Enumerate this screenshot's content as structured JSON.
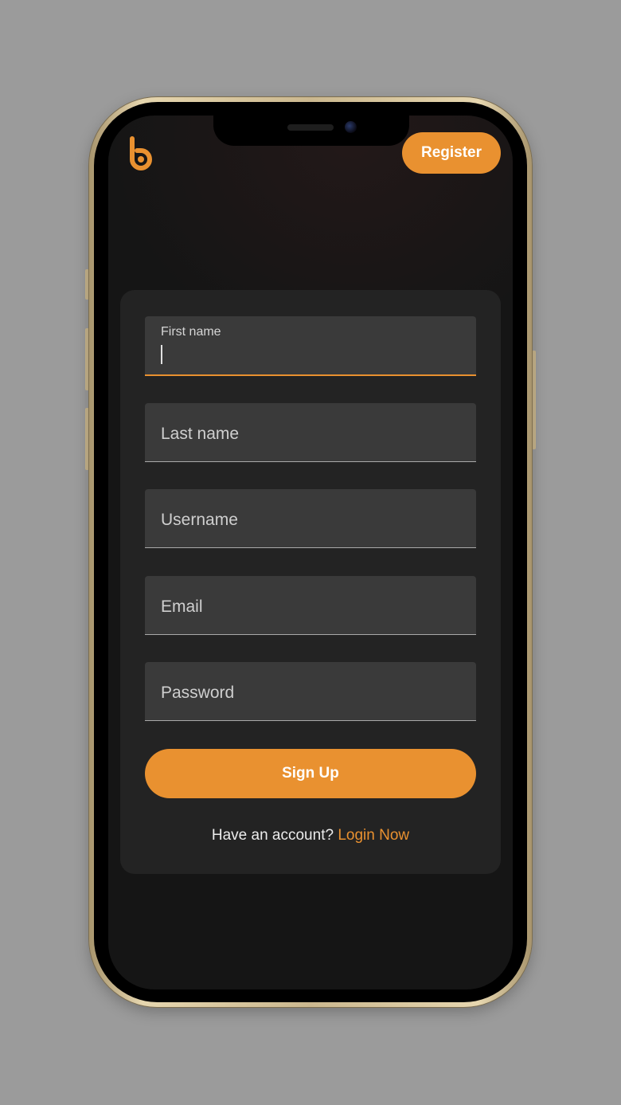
{
  "header": {
    "logo_icon": "brand-b-logo-icon",
    "register_label": "Register"
  },
  "form": {
    "fields": [
      {
        "label": "First name",
        "value": "",
        "focused": true
      },
      {
        "label": "Last name",
        "value": "",
        "focused": false
      },
      {
        "label": "Username",
        "value": "",
        "focused": false
      },
      {
        "label": "Email",
        "value": "",
        "focused": false
      },
      {
        "label": "Password",
        "value": "",
        "focused": false
      }
    ],
    "submit_label": "Sign Up",
    "footer_text": "Have an account?",
    "login_link": "Login Now"
  },
  "colors": {
    "accent": "#e99130",
    "background": "#151515",
    "card": "#232323",
    "field": "#3a3a3a"
  }
}
